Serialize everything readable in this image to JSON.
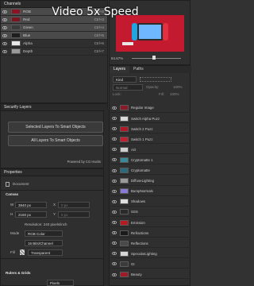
{
  "overlay": {
    "title": "Video 5x Speed"
  },
  "channels": {
    "title": "Channels",
    "rows": [
      {
        "name": "RGB",
        "shortcut": "Ctrl+2",
        "color": "#8a1424",
        "selected": true
      },
      {
        "name": "Red",
        "shortcut": "Ctrl+3",
        "color": "#7a1620",
        "selected": true
      },
      {
        "name": "Green",
        "shortcut": "Ctrl+4",
        "color": "#3a3a3a",
        "selected": true
      },
      {
        "name": "Blue",
        "shortcut": "Ctrl+5",
        "color": "#1e1e1e",
        "selected": true
      },
      {
        "name": "Alpha",
        "shortcut": "Ctrl+6",
        "color": "#e8e8e8",
        "selected": false
      },
      {
        "name": "Depth",
        "shortcut": "Ctrl+7",
        "color": "#9a9a9a",
        "selected": false
      }
    ]
  },
  "plugin": {
    "title": "Securify Layers",
    "btn_selected": "Selected Layers To Smart Objects",
    "btn_all": "All Layers To Smart Objects",
    "credit": "Powered by CG Hacks"
  },
  "properties": {
    "title": "Properties",
    "doc_label": "Document",
    "canvas_title": "Canvas",
    "w_label": "W",
    "w_value": "3840 px",
    "h_label": "H",
    "h_value": "2160 px",
    "x_label": "X",
    "x_value": "0 px",
    "y_label": "Y",
    "y_value": "0 px",
    "resolution": "Resolution: 240 pixels/inch",
    "mode_label": "Mode",
    "mode_value": "RGB Color",
    "depth_value": "16 Bits/Channel",
    "fill_label": "Fill",
    "fill_value": "Transparent",
    "rulers_title": "Rulers & Grids",
    "units_value": "Pixels"
  },
  "navigator": {
    "zoom": "84.67%"
  },
  "layers": {
    "tab_layers": "Layers",
    "tab_paths": "Paths",
    "kind": "Kind",
    "mode": "Normal",
    "opacity_label": "Opacity:",
    "opacity_value": "100%",
    "lock_label": "Lock:",
    "fill_label": "Fill:",
    "fill_value": "100%",
    "items": [
      {
        "name": "Regular Image",
        "color": "#8a1a28"
      },
      {
        "name": "Switch Alpha Puzz",
        "color": "#d8d8d8"
      },
      {
        "name": "Switch 2 Puzz",
        "color": "#b01828"
      },
      {
        "name": "Switch 1 Puzz",
        "color": "#c02030"
      },
      {
        "name": "AO",
        "color": "#cfcfcf"
      },
      {
        "name": "Cryptomatte 1",
        "color": "#3a8a9a"
      },
      {
        "name": "Cryptomatte",
        "color": "#2a6a7a"
      },
      {
        "name": "DiffuseLighting",
        "color": "#9a9a9a"
      },
      {
        "name": "BumpNormals",
        "color": "#8a7ad8"
      },
      {
        "name": "Shadows",
        "color": "#e0e0e0"
      },
      {
        "name": "SSS",
        "color": "#2a2a2a"
      },
      {
        "name": "Emission",
        "color": "#b81a24"
      },
      {
        "name": "Refractions",
        "color": "#1a1a1a"
      },
      {
        "name": "Reflections",
        "color": "#4a4a4a"
      },
      {
        "name": "SpecularLighting",
        "color": "#d8d8d8"
      },
      {
        "name": "GI",
        "color": "#3a3a3a"
      },
      {
        "name": "Beauty",
        "color": "#a01a28"
      }
    ]
  }
}
